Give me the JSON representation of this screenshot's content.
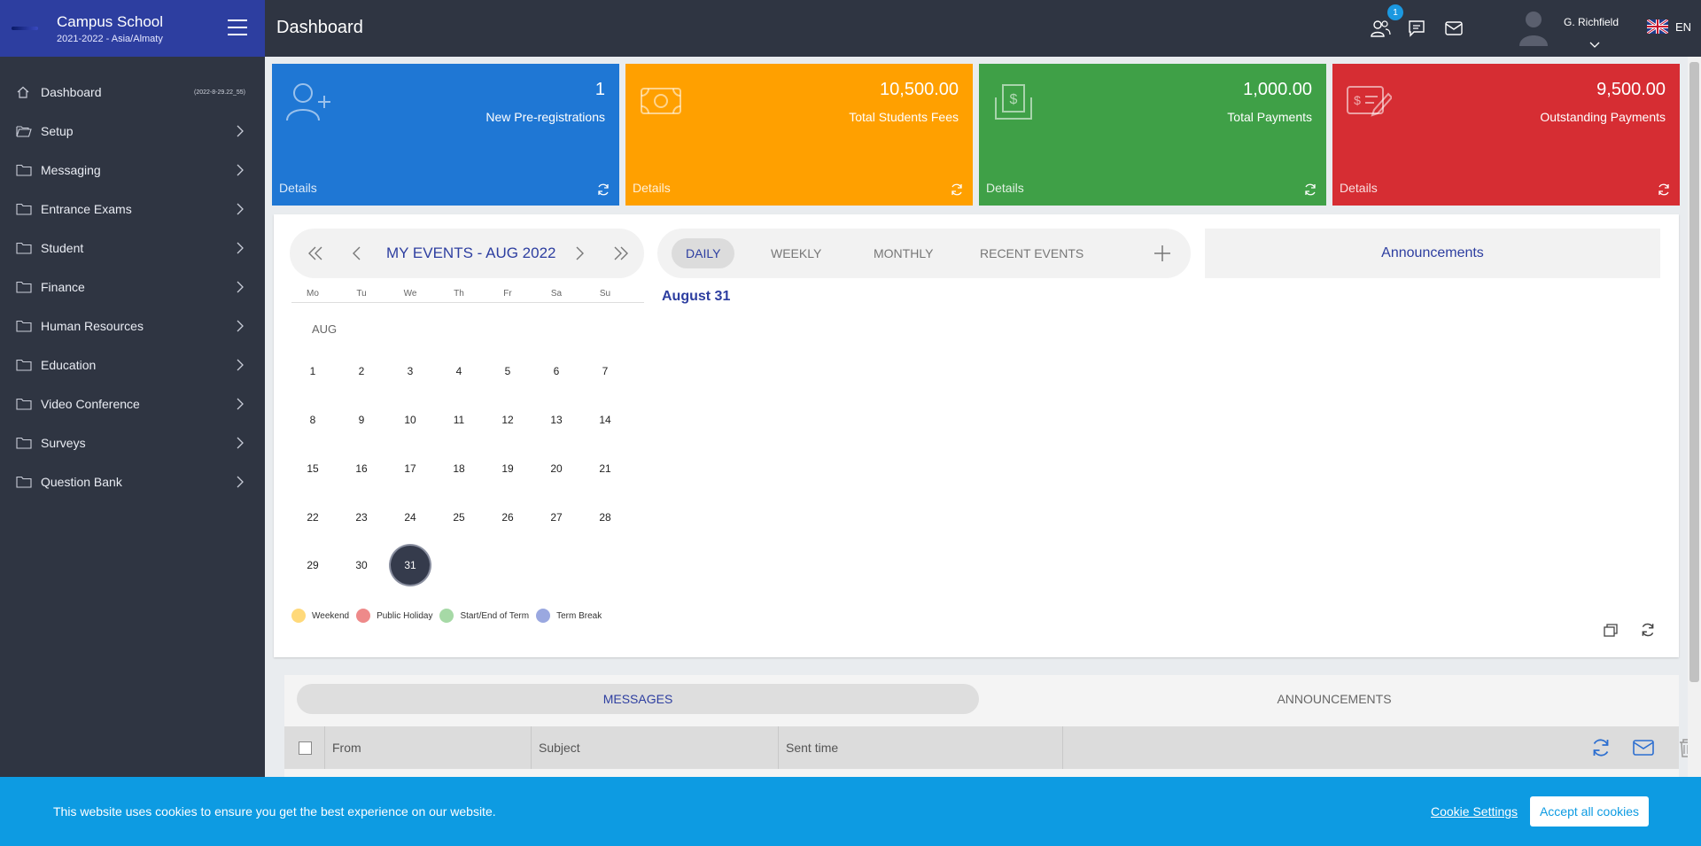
{
  "app": {
    "school_name": "Campus School",
    "school_sub": "2021-2022 - Asia/Almaty"
  },
  "topbar": {
    "title": "Dashboard",
    "notification_count": "1",
    "user_name": "G. Richfield",
    "language": "EN"
  },
  "sidebar": {
    "items": [
      {
        "label": "Dashboard",
        "meta": "(2022-8-29.22_55)",
        "icon": "home-icon"
      },
      {
        "label": "Setup",
        "icon": "folder-open-icon"
      },
      {
        "label": "Messaging",
        "icon": "folder-icon"
      },
      {
        "label": "Entrance Exams",
        "icon": "folder-icon"
      },
      {
        "label": "Student",
        "icon": "folder-icon"
      },
      {
        "label": "Finance",
        "icon": "folder-icon"
      },
      {
        "label": "Human Resources",
        "icon": "folder-icon"
      },
      {
        "label": "Education",
        "icon": "folder-icon"
      },
      {
        "label": "Video Conference",
        "icon": "folder-icon"
      },
      {
        "label": "Surveys",
        "icon": "folder-icon"
      },
      {
        "label": "Question Bank",
        "icon": "folder-icon"
      }
    ]
  },
  "stats": [
    {
      "value": "1",
      "label": "New Pre-registrations",
      "details": "Details",
      "color": "#1f77d4",
      "icon": "user-plus-icon"
    },
    {
      "value": "10,500.00",
      "label": "Total Students Fees",
      "details": "Details",
      "color": "#ffa000",
      "icon": "cash-icon"
    },
    {
      "value": "1,000.00",
      "label": "Total Payments",
      "details": "Details",
      "color": "#3fa047",
      "icon": "payment-icon"
    },
    {
      "value": "9,500.00",
      "label": "Outstanding Payments",
      "details": "Details",
      "color": "#d62d33",
      "icon": "invoice-icon"
    }
  ],
  "calendar": {
    "title": "MY EVENTS - AUG 2022",
    "weekdays": [
      "Mo",
      "Tu",
      "We",
      "Th",
      "Fr",
      "Sa",
      "Su"
    ],
    "month_label": "AUG",
    "weeks": [
      [
        "1",
        "2",
        "3",
        "4",
        "5",
        "6",
        "7"
      ],
      [
        "8",
        "9",
        "10",
        "11",
        "12",
        "13",
        "14"
      ],
      [
        "15",
        "16",
        "17",
        "18",
        "19",
        "20",
        "21"
      ],
      [
        "22",
        "23",
        "24",
        "25",
        "26",
        "27",
        "28"
      ],
      [
        "29",
        "30",
        "31"
      ]
    ],
    "selected_day": "31",
    "legend": [
      {
        "label": "Weekend",
        "color": "#ffd97a"
      },
      {
        "label": "Public Holiday",
        "color": "#ee8a8a"
      },
      {
        "label": "Start/End of Term",
        "color": "#a6d9a6"
      },
      {
        "label": "Term Break",
        "color": "#9aa8e0"
      }
    ]
  },
  "views": {
    "tabs": [
      "DAILY",
      "WEEKLY",
      "MONTHLY",
      "RECENT EVENTS"
    ],
    "active": "DAILY",
    "day_title": "August 31"
  },
  "announcements": {
    "title": "Announcements"
  },
  "messages": {
    "tabs": [
      "MESSAGES",
      "ANNOUNCEMENTS"
    ],
    "columns": [
      "From",
      "Subject",
      "Sent time"
    ]
  },
  "cookie": {
    "text": "This website uses cookies to ensure you get the best experience on our website.",
    "settings": "Cookie Settings",
    "accept": "Accept all cookies"
  }
}
